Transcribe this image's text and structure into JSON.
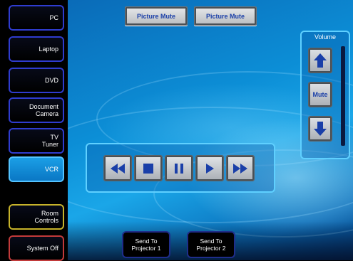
{
  "sources": [
    {
      "label": "PC",
      "active": false
    },
    {
      "label": "Laptop",
      "active": false
    },
    {
      "label": "DVD",
      "active": false
    },
    {
      "label": "Document\nCamera",
      "active": false
    },
    {
      "label": "TV\nTuner",
      "active": false
    },
    {
      "label": "VCR",
      "active": true
    }
  ],
  "room_controls_label": "Room\nControls",
  "system_off_label": "System Off",
  "picture_mute": [
    "Picture Mute",
    "Picture Mute"
  ],
  "volume": {
    "title": "Volume",
    "up_icon": "volume-up-icon",
    "mute_label": "Mute",
    "down_icon": "volume-down-icon",
    "level_fraction": 0.0
  },
  "transport": [
    "rewind-icon",
    "stop-icon",
    "pause-icon",
    "play-icon",
    "fast-forward-icon"
  ],
  "send": [
    "Send To\nProjector 1",
    "Send To\nProjector 2"
  ],
  "colors": {
    "accent": "#5fd0ff",
    "button_text": "#1a3fa8",
    "active_source": "#1b9fe6"
  }
}
